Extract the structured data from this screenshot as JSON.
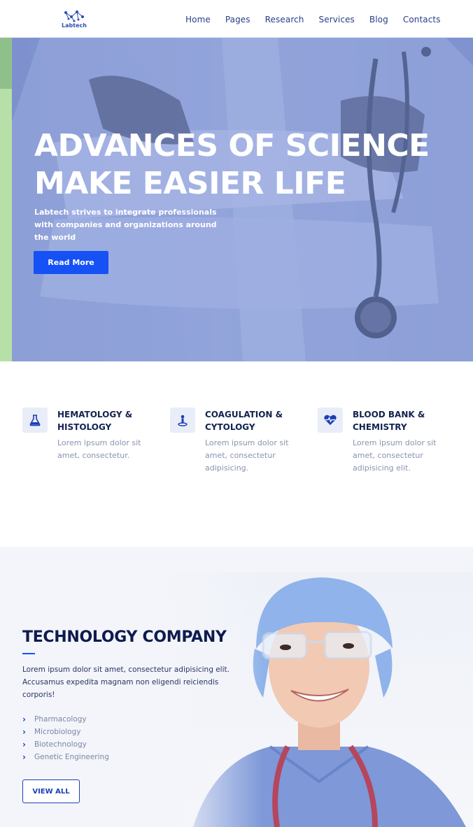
{
  "header": {
    "logo_text": "Labtech",
    "nav": [
      "Home",
      "Pages",
      "Research",
      "Services",
      "Blog",
      "Contacts"
    ]
  },
  "hero": {
    "title_line1": "ADVANCES OF SCIENCE",
    "title_line2": "MAKE EASIER LIFE",
    "subtitle": "Labtech strives to integrate professionals with companies and organizations around the world",
    "button_label": "Read More"
  },
  "services": [
    {
      "title": "HEMATOLOGY & HISTOLOGY",
      "text": "Lorem ipsum dolor sit amet, consectetur.",
      "icon": "flask-icon"
    },
    {
      "title": "COAGULATION & CYTOLOGY",
      "text": "Lorem ipsum dolor sit amet, consectetur adipisicing.",
      "icon": "microscope-icon"
    },
    {
      "title": "BLOOD BANK & CHEMISTRY",
      "text": "Lorem ipsum dolor sit amet, consectetur adipisicing elit.",
      "icon": "heart-pulse-icon"
    }
  ],
  "tech": {
    "title": "TECHNOLOGY COMPANY",
    "text": "Lorem ipsum dolor sit amet, consectetur adipisicing elit. Accusamus expedita magnam non eligendi reiciendis corporis!",
    "list": [
      "Pharmacology",
      "Microbiology",
      "Biotechnology",
      "Genetic Engineering"
    ],
    "button_label": "VIEW ALL"
  },
  "colors": {
    "accent": "#1551f5",
    "navy": "#0e1b4d",
    "hero_tint": "#8a9bd3",
    "green": "#b7e0a8"
  }
}
